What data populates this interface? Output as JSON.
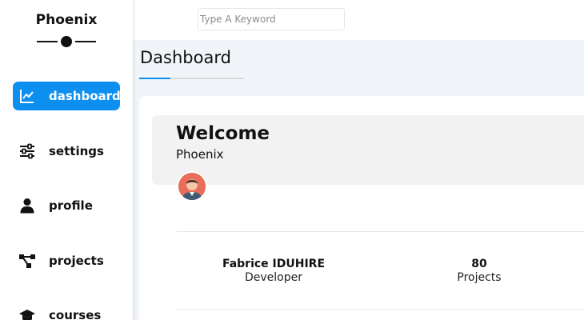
{
  "sidebar": {
    "brand": "Phoenix",
    "items": [
      {
        "label": "dashboard",
        "icon": "chart-line-icon",
        "active": true
      },
      {
        "label": "settings",
        "icon": "sliders-icon",
        "active": false
      },
      {
        "label": "profile",
        "icon": "user-icon",
        "active": false
      },
      {
        "label": "projects",
        "icon": "project-diagram-icon",
        "active": false
      },
      {
        "label": "courses",
        "icon": "graduation-cap-icon",
        "active": false
      }
    ]
  },
  "header": {
    "search_placeholder": "Type A Keyword"
  },
  "main": {
    "title": "Dashboard",
    "welcome": {
      "title": "Welcome",
      "subtitle": "Phoenix"
    },
    "profile": {
      "name": "Fabrice IDUHIRE",
      "role": "Developer",
      "projects_count": "80",
      "projects_label": "Projects"
    }
  },
  "colors": {
    "accent": "#0c8fef",
    "background": "#f1f5f9",
    "avatar_bg": "#e86d5a"
  }
}
